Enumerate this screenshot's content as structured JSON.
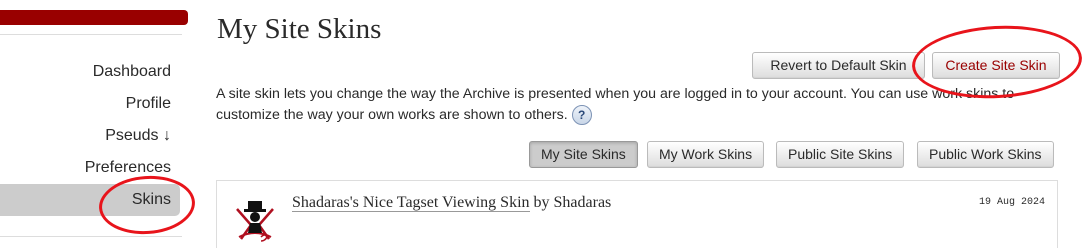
{
  "sidebar": {
    "accent_color": "#990000",
    "items": [
      {
        "label": "Dashboard"
      },
      {
        "label": "Profile"
      },
      {
        "label": "Pseuds ↓"
      },
      {
        "label": "Preferences"
      },
      {
        "label": "Skins",
        "active": true
      }
    ]
  },
  "main": {
    "title": "My Site Skins",
    "actions": {
      "revert_label": "Revert to Default Skin",
      "create_label": "Create Site Skin"
    },
    "description": "A site skin lets you change the way the Archive is presented when you are logged in to your account. You can use work skins to customize the way your own works are shown to others.",
    "help_label": "?",
    "tabs": [
      {
        "label": "My Site Skins",
        "current": true
      },
      {
        "label": "My Work Skins"
      },
      {
        "label": "Public Site Skins"
      },
      {
        "label": "Public Work Skins"
      }
    ],
    "skins": [
      {
        "title": "Shadaras's Nice Tagset Viewing Skin",
        "by": "by",
        "author": "Shadaras",
        "date": "19 Aug 2024",
        "icon": "skin-avatar-icon"
      }
    ]
  },
  "annotation_color": "#e8141b"
}
